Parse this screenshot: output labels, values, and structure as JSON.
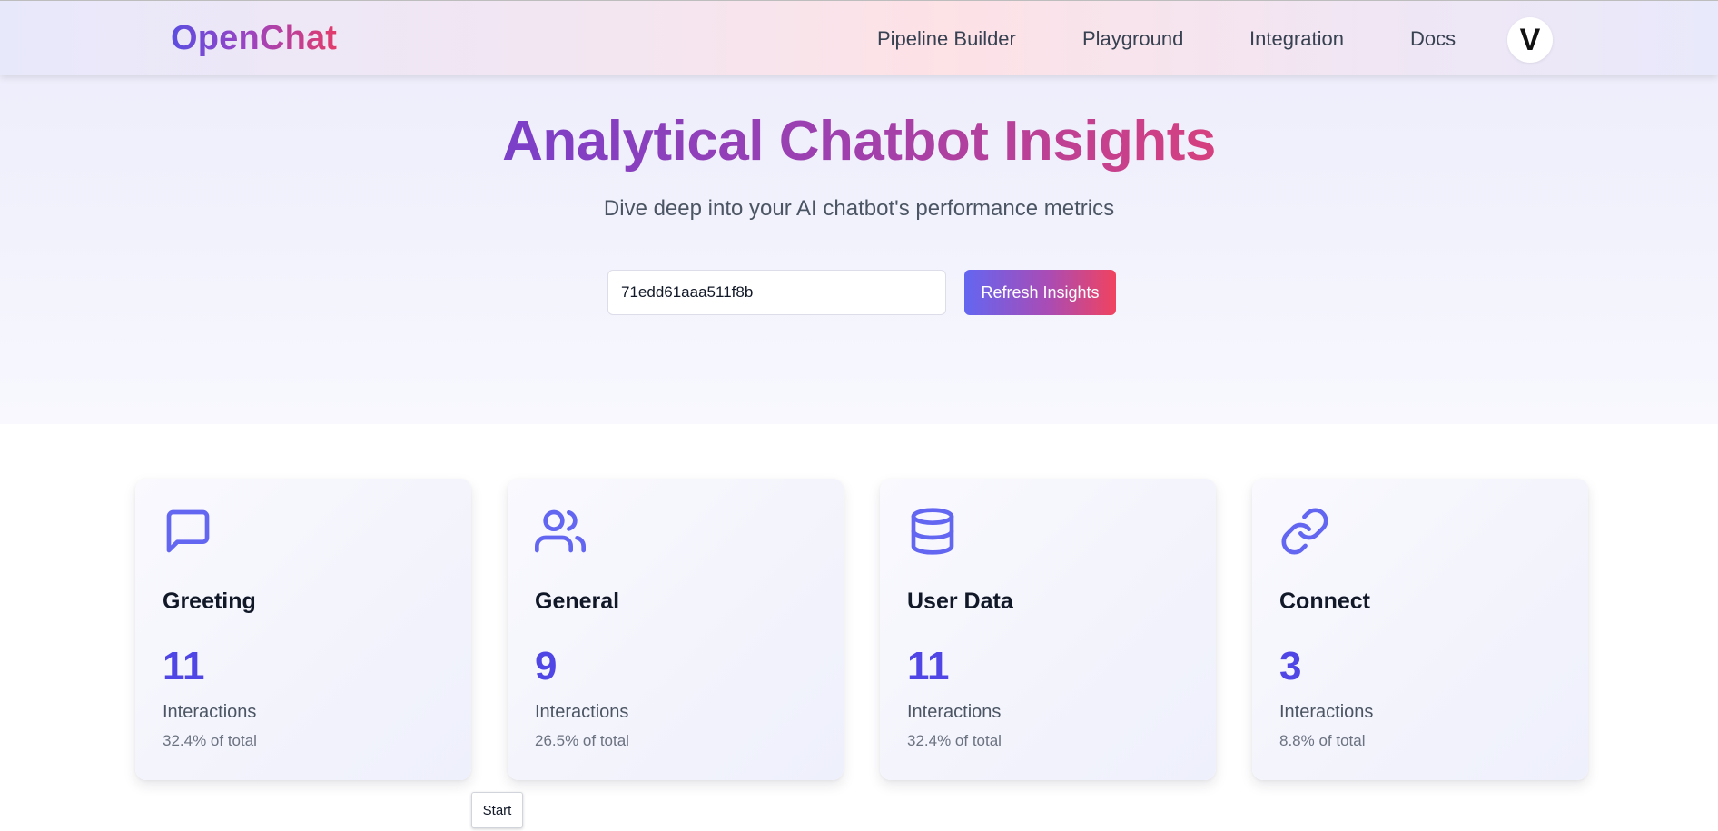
{
  "nav": {
    "logo_part1": "Open",
    "logo_part2": "Chat",
    "links": [
      "Pipeline Builder",
      "Playground",
      "Integration",
      "Docs"
    ],
    "avatar_letter": "V"
  },
  "hero": {
    "title": "Analytical Chatbot Insights",
    "subtitle": "Dive deep into your AI chatbot's performance metrics",
    "chatbot_id_value": "71edd61aaa511f8b",
    "refresh_label": "Refresh Insights"
  },
  "cards": [
    {
      "icon": "message-square-icon",
      "title": "Greeting",
      "count": "11",
      "label": "Interactions",
      "percent": "32.4% of total"
    },
    {
      "icon": "users-icon",
      "title": "General",
      "count": "9",
      "label": "Interactions",
      "percent": "26.5% of total"
    },
    {
      "icon": "database-icon",
      "title": "User Data",
      "count": "11",
      "label": "Interactions",
      "percent": "32.4% of total"
    },
    {
      "icon": "link-icon",
      "title": "Connect",
      "count": "3",
      "label": "Interactions",
      "percent": "8.8% of total"
    }
  ],
  "tooltip": {
    "label": "Start"
  },
  "colors": {
    "accent": "#6366f1",
    "count_color": "#4f46e5",
    "gradient_start": "#6366f1",
    "gradient_end": "#f0435f"
  }
}
